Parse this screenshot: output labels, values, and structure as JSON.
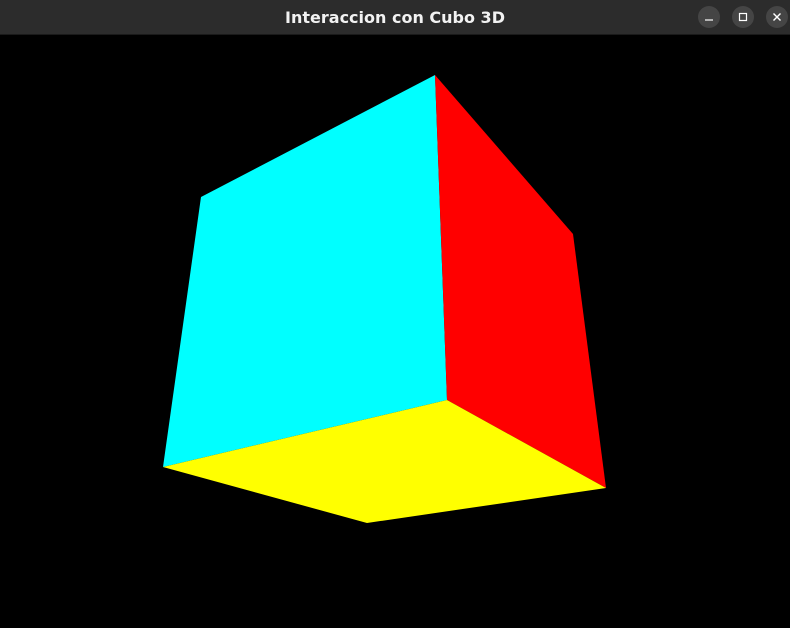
{
  "window": {
    "title": "Interaccion con Cubo 3D",
    "titlebar_color": "#2c2c2c",
    "buttons": [
      {
        "name": "minimize",
        "icon": "minimize-icon"
      },
      {
        "name": "maximize",
        "icon": "maximize-icon"
      },
      {
        "name": "close",
        "icon": "close-icon"
      }
    ]
  },
  "scene": {
    "background_color": "#000000",
    "cube_faces": [
      {
        "name": "front",
        "color": "#00ffff"
      },
      {
        "name": "right",
        "color": "#ff0000"
      },
      {
        "name": "bottom",
        "color": "#ffff00"
      }
    ]
  }
}
